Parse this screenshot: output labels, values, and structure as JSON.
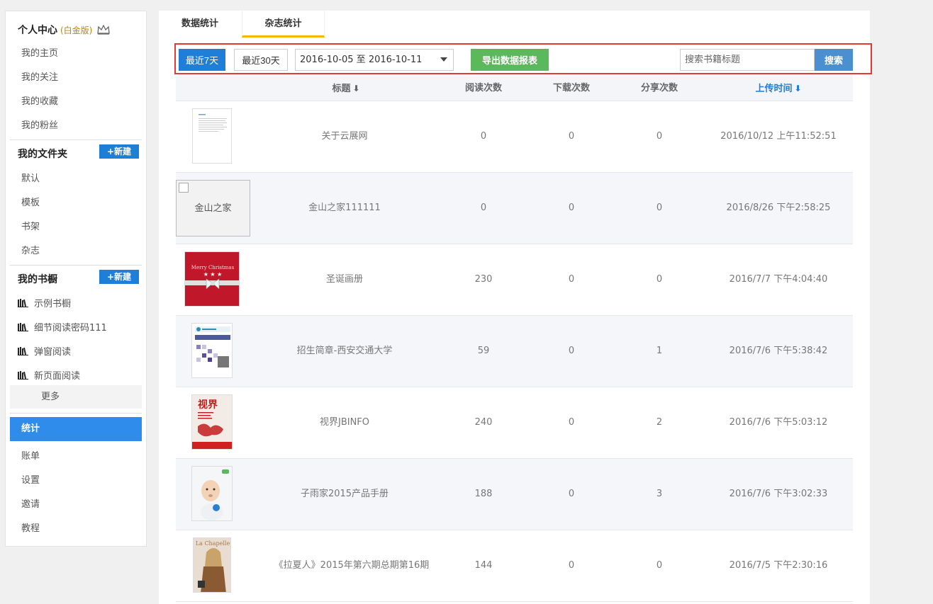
{
  "sidebar": {
    "personal_center": "个人中心",
    "edition": "(白金版)",
    "personal_items": [
      "我的主页",
      "我的关注",
      "我的收藏",
      "我的粉丝"
    ],
    "folders_title": "我的文件夹",
    "new_label": "+新建",
    "folder_items": [
      "默认",
      "模板",
      "书架",
      "杂志"
    ],
    "bookcase_title": "我的书橱",
    "bookcase_items": [
      "示例书橱",
      "细节阅读密码111",
      "弹窗阅读",
      "新页面阅读"
    ],
    "more": "更多",
    "active_item": "统计",
    "bottom_items": [
      "账单",
      "设置",
      "邀请",
      "教程"
    ]
  },
  "tabs": [
    "数据统计",
    "杂志统计"
  ],
  "toolbar": {
    "last7": "最近7天",
    "last30": "最近30天",
    "date_range": "2016-10-05 至 2016-10-11",
    "export": "导出数据报表",
    "search_placeholder": "搜索书籍标题",
    "search_button": "搜索"
  },
  "table": {
    "headers": [
      "标题",
      "阅读次数",
      "下载次数",
      "分享次数",
      "上传时间"
    ],
    "rows": [
      {
        "title": "关于云展网",
        "reads": "0",
        "downloads": "0",
        "shares": "0",
        "time": "2016/10/12 上午11:52:51",
        "cover": "doc"
      },
      {
        "title": "金山之家111111",
        "reads": "0",
        "downloads": "0",
        "shares": "0",
        "time": "2016/8/26 下午2:58:25",
        "cover": "broken",
        "cover_alt": "金山之家"
      },
      {
        "title": "圣诞画册",
        "reads": "230",
        "downloads": "0",
        "shares": "0",
        "time": "2016/7/7 下午4:04:40",
        "cover": "christmas"
      },
      {
        "title": "招生简章-西安交通大学",
        "reads": "59",
        "downloads": "0",
        "shares": "1",
        "time": "2016/7/6 下午5:38:42",
        "cover": "university"
      },
      {
        "title": "视界JBINFO",
        "reads": "240",
        "downloads": "0",
        "shares": "2",
        "time": "2016/7/6 下午5:03:12",
        "cover": "red-poster"
      },
      {
        "title": "子雨家2015产品手册",
        "reads": "188",
        "downloads": "0",
        "shares": "3",
        "time": "2016/7/6 下午3:02:33",
        "cover": "baby"
      },
      {
        "title": "《拉夏人》2015年第六期总期第16期",
        "reads": "144",
        "downloads": "0",
        "shares": "0",
        "time": "2016/7/5 下午2:30:16",
        "cover": "fashion"
      }
    ]
  }
}
